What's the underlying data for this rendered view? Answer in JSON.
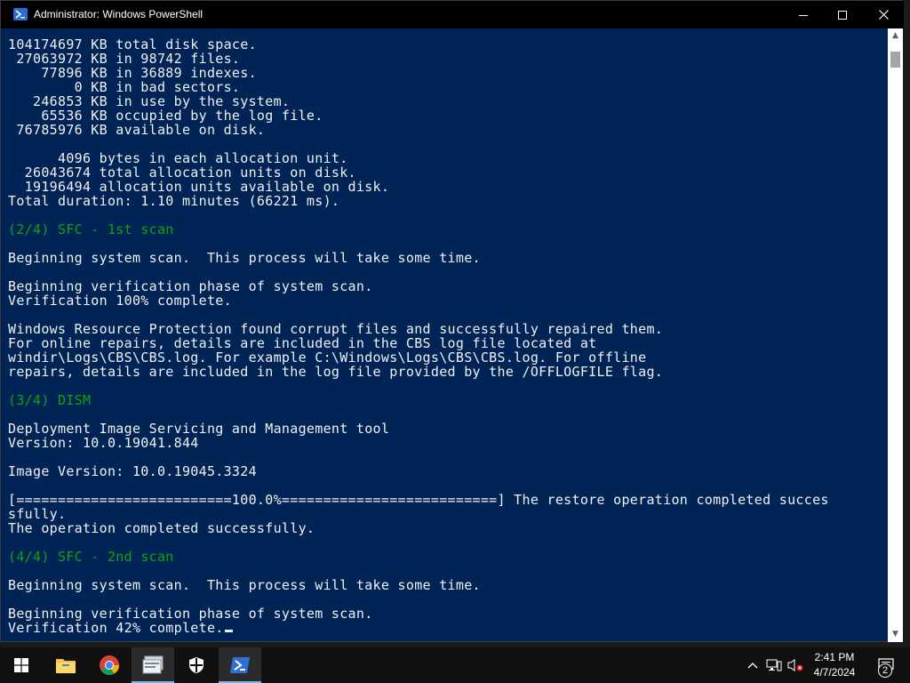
{
  "window": {
    "title": "Administrator: Windows PowerShell"
  },
  "console": {
    "lines": [
      {
        "text": "104174697 KB total disk space."
      },
      {
        "text": " 27063972 KB in 98742 files."
      },
      {
        "text": "    77896 KB in 36889 indexes."
      },
      {
        "text": "        0 KB in bad sectors."
      },
      {
        "text": "   246853 KB in use by the system."
      },
      {
        "text": "    65536 KB occupied by the log file."
      },
      {
        "text": " 76785976 KB available on disk."
      },
      {
        "text": ""
      },
      {
        "text": "      4096 bytes in each allocation unit."
      },
      {
        "text": "  26043674 total allocation units on disk."
      },
      {
        "text": "  19196494 allocation units available on disk."
      },
      {
        "text": "Total duration: 1.10 minutes (66221 ms)."
      },
      {
        "text": ""
      },
      {
        "text": "(2/4) SFC - 1st scan",
        "color": "green"
      },
      {
        "text": ""
      },
      {
        "text": "Beginning system scan.  This process will take some time."
      },
      {
        "text": ""
      },
      {
        "text": "Beginning verification phase of system scan."
      },
      {
        "text": "Verification 100% complete."
      },
      {
        "text": ""
      },
      {
        "text": "Windows Resource Protection found corrupt files and successfully repaired them."
      },
      {
        "text": "For online repairs, details are included in the CBS log file located at"
      },
      {
        "text": "windir\\Logs\\CBS\\CBS.log. For example C:\\Windows\\Logs\\CBS\\CBS.log. For offline"
      },
      {
        "text": "repairs, details are included in the log file provided by the /OFFLOGFILE flag."
      },
      {
        "text": ""
      },
      {
        "text": "(3/4) DISM",
        "color": "green"
      },
      {
        "text": ""
      },
      {
        "text": "Deployment Image Servicing and Management tool"
      },
      {
        "text": "Version: 10.0.19041.844"
      },
      {
        "text": ""
      },
      {
        "text": "Image Version: 10.0.19045.3324"
      },
      {
        "text": ""
      },
      {
        "text": "[==========================100.0%==========================] The restore operation completed succes"
      },
      {
        "text": "sfully."
      },
      {
        "text": "The operation completed successfully."
      },
      {
        "text": ""
      },
      {
        "text": "(4/4) SFC - 2nd scan",
        "color": "green"
      },
      {
        "text": ""
      },
      {
        "text": "Beginning system scan.  This process will take some time."
      },
      {
        "text": ""
      },
      {
        "text": "Beginning verification phase of system scan."
      },
      {
        "text": "Verification 42% complete.",
        "cursor": true
      }
    ]
  },
  "taskbar": {
    "clock_time": "2:41 PM",
    "clock_date": "4/7/2024",
    "notification_count": "2",
    "apps": [
      "start",
      "file-explorer",
      "chrome",
      "app-window",
      "security",
      "powershell"
    ],
    "active_app": "powershell"
  },
  "colors": {
    "console_bg": "#012456",
    "console_fg": "#f0f0f0",
    "heading_green": "#13a10e",
    "titlebar_bg": "#000000",
    "taskbar_bg": "#101010",
    "taskbar_active_underline": "#76b9ed"
  }
}
